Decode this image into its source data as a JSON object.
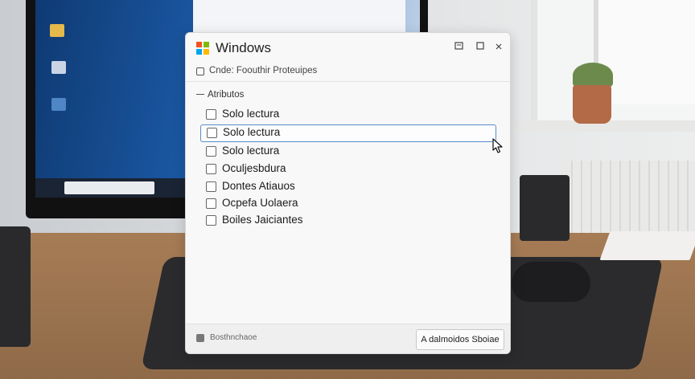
{
  "dialog": {
    "title": "Windows",
    "subheader": "Cnde: Foouthir Proteuipes",
    "group_label": "Atributos",
    "items": [
      {
        "label": "Solo lectura",
        "checked": false
      },
      {
        "label": "Solo lectura",
        "checked": false,
        "selected": true
      },
      {
        "label": "Solo lectura",
        "checked": false
      },
      {
        "label": "Oculjesbdura",
        "checked": false
      },
      {
        "label": "Dontes Atiauos",
        "checked": false
      },
      {
        "label": "Ocpefa Uolaera",
        "checked": false
      },
      {
        "label": "Boiles Jaiciantes",
        "checked": false
      }
    ],
    "footer_label": "Bosthnchaoe",
    "apply_button": "A dalmoidos Sboiae"
  },
  "icons": {
    "logo": "windows-logo-icon",
    "restore": "restore-icon",
    "maximize": "maximize-icon",
    "close": "close-icon",
    "cursor": "mouse-pointer-icon"
  },
  "colors": {
    "selection_border": "#5a8cc9",
    "logo": [
      "#f25022",
      "#7fba00",
      "#00a4ef",
      "#ffb900"
    ]
  }
}
